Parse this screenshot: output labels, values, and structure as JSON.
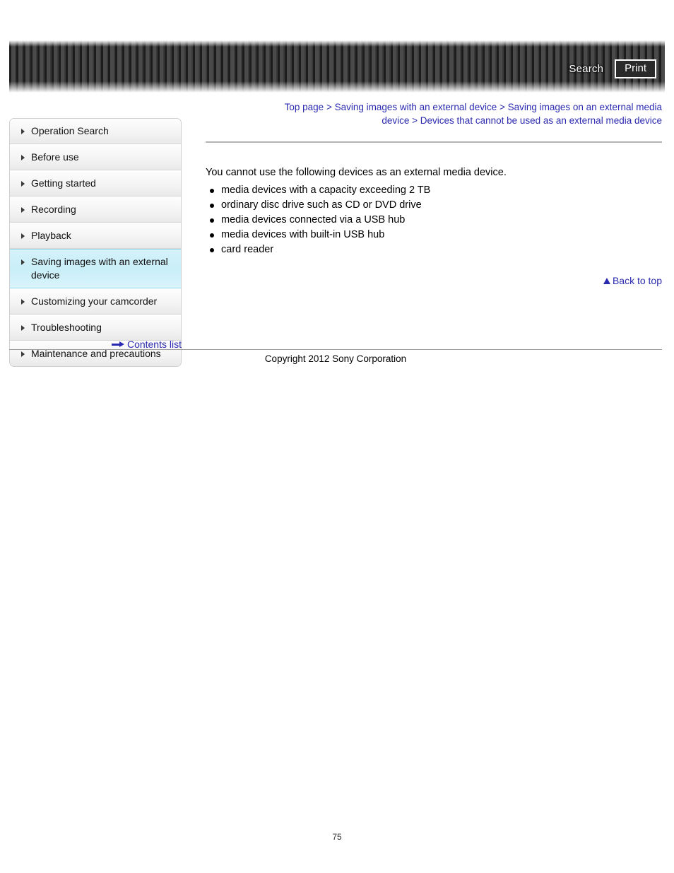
{
  "header": {
    "search_label": "Search",
    "print_label": "Print",
    "search_icon": "search-icon",
    "print_icon": "print-icon"
  },
  "breadcrumb": {
    "separator": " > ",
    "items": [
      {
        "label": "Top page"
      },
      {
        "label": "Saving images with an external device"
      },
      {
        "label": "Saving images on an external media device"
      },
      {
        "label": "Devices that cannot be used as an external media device"
      }
    ]
  },
  "sidebar": {
    "items": [
      {
        "label": "Operation Search",
        "active": false
      },
      {
        "label": "Before use",
        "active": false
      },
      {
        "label": "Getting started",
        "active": false
      },
      {
        "label": "Recording",
        "active": false
      },
      {
        "label": "Playback",
        "active": false
      },
      {
        "label": "Saving images with an external device",
        "active": true
      },
      {
        "label": "Customizing your camcorder",
        "active": false
      },
      {
        "label": "Troubleshooting",
        "active": false
      },
      {
        "label": "Maintenance and precautions",
        "active": false
      }
    ],
    "contents_link": "Contents list",
    "contents_icon": "arrow-right-icon"
  },
  "main": {
    "intro": "You cannot use the following devices as an external media device.",
    "devices": [
      "media devices with a capacity exceeding 2 TB",
      "ordinary disc drive such as CD or DVD drive",
      "media devices connected via a USB hub",
      "media devices with built-in USB hub",
      "card reader"
    ],
    "back_to_top": "Back to top",
    "back_to_top_icon": "triangle-up-icon"
  },
  "footer": {
    "copyright": "Copyright 2012 Sony Corporation"
  },
  "page": {
    "number": "75"
  },
  "colors": {
    "link": "#2a2ab0",
    "active_nav_bg": "#cceef8",
    "active_nav_border": "#8fd6e6",
    "banner_dark": "#1c1c1c",
    "rule": "#b3b3b3"
  }
}
